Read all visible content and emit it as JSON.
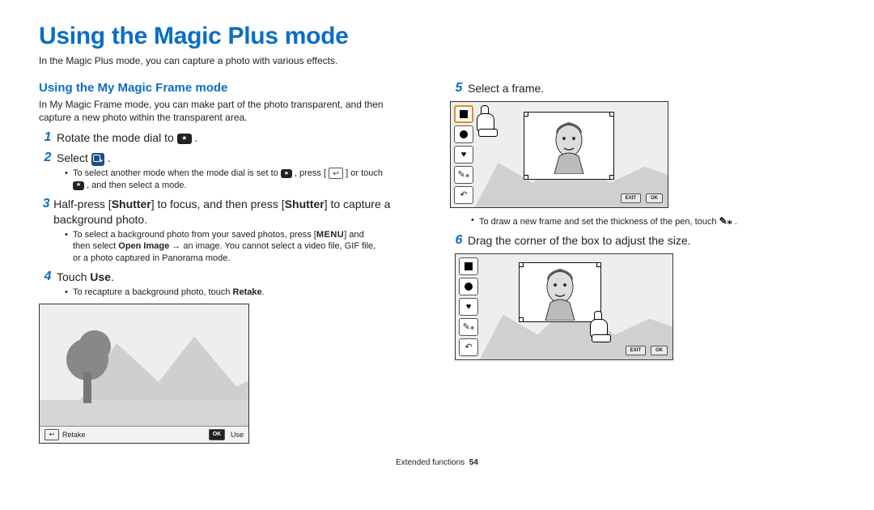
{
  "title": "Using the Magic Plus mode",
  "intro": "In the Magic Plus mode, you can capture a photo with various effects.",
  "left": {
    "subtitle": "Using the My Magic Frame mode",
    "subdesc": "In My Magic Frame mode, you can make part of the photo transparent, and then capture a new photo within the transparent area.",
    "step1": {
      "num": "1",
      "text_a": "Rotate the mode dial to ",
      "text_b": "."
    },
    "step2": {
      "num": "2",
      "text_a": "Select ",
      "text_b": "."
    },
    "bullet2a_a": "To select another mode when the mode dial is set to ",
    "bullet2a_b": ", press [",
    "bullet2a_c": "] or touch",
    "bullet2b_a": "",
    "bullet2b_b": ", and then select a mode.",
    "step3": {
      "num": "3",
      "text_a": "Half-press [",
      "shutter1": "Shutter",
      "text_b": "] to focus, and then press [",
      "shutter2": "Shutter",
      "text_c": "] to capture a background photo."
    },
    "bullet3a_a": "To select a background photo from your saved photos, press [",
    "bullet3a_menu": "MENU",
    "bullet3a_b": "] and",
    "bullet3b_a": "then select ",
    "bullet3b_open": "Open Image",
    "bullet3b_b": " → an image. You cannot select a video file, GIF file,",
    "bullet3c": "or a photo captured in Panorama mode.",
    "step4": {
      "num": "4",
      "text_a": "Touch ",
      "use": "Use",
      "text_b": "."
    },
    "bullet4_a": "To recapture a background photo, touch ",
    "bullet4_retake": "Retake",
    "bullet4_b": ".",
    "fig1": {
      "retake": "Retake",
      "ok": "OK",
      "use": "Use"
    }
  },
  "right": {
    "step5": {
      "num": "5",
      "text": "Select a frame."
    },
    "bullet5_a": "To draw a new frame and set the thickness of the pen, touch ",
    "bullet5_b": ".",
    "step6": {
      "num": "6",
      "text": "Drag the corner of the box to adjust the size."
    },
    "exit": "EXIT",
    "ok": "OK"
  },
  "footer": {
    "section": "Extended functions",
    "page": "54"
  }
}
